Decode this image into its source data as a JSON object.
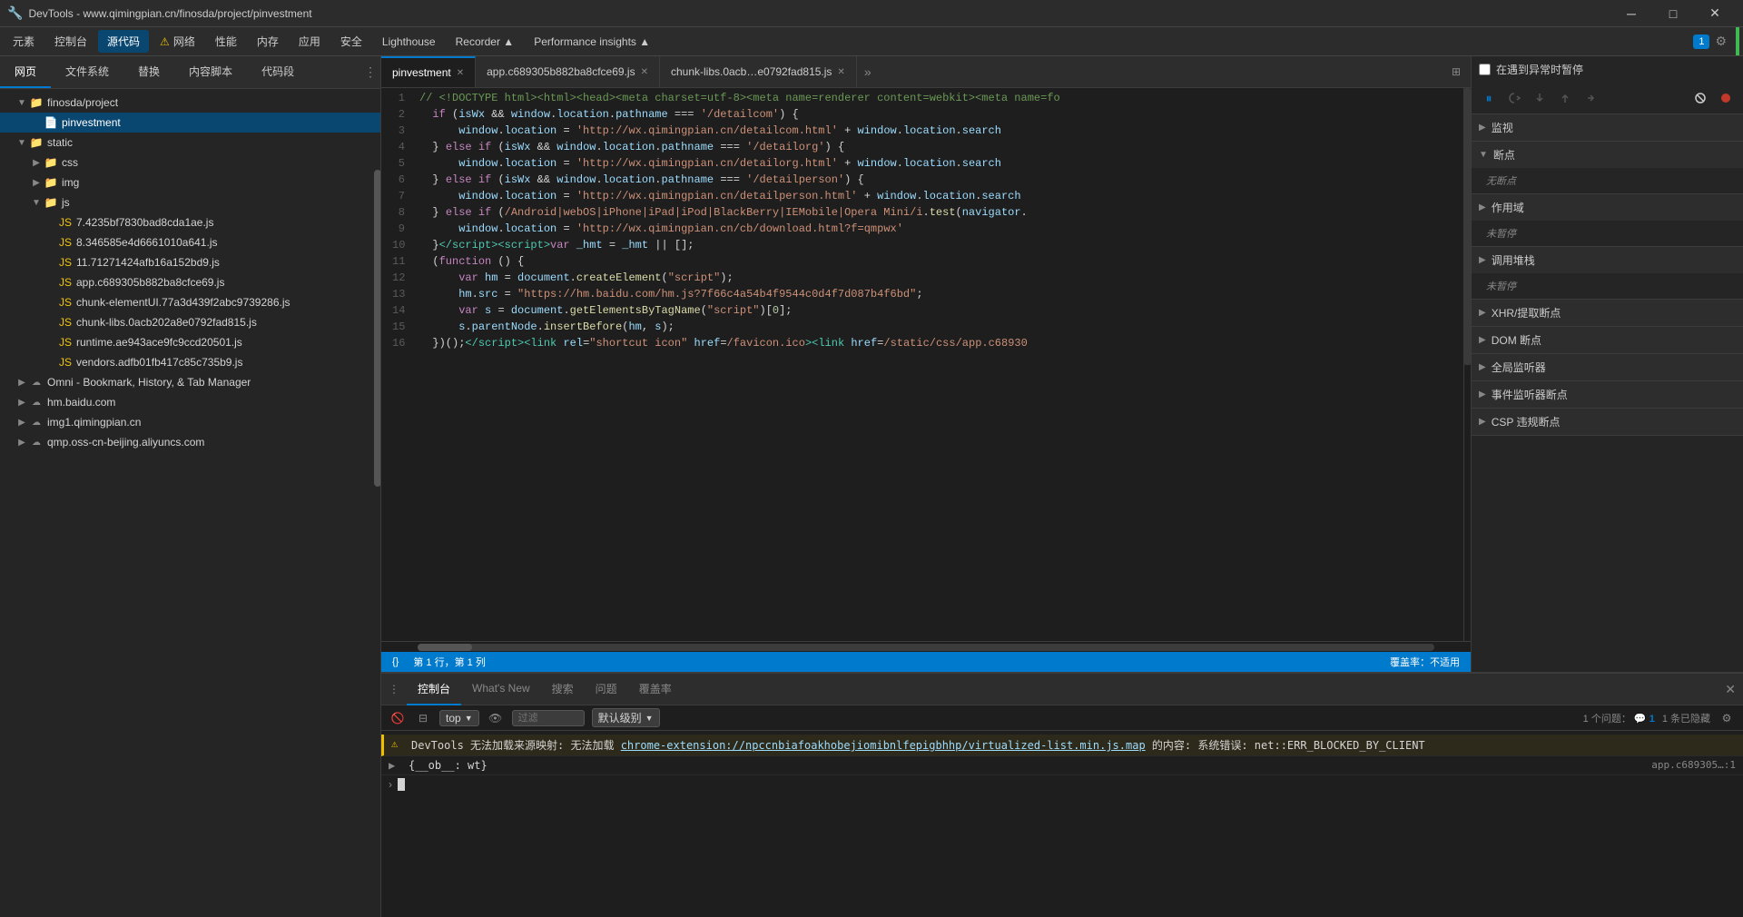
{
  "titlebar": {
    "title": "DevTools - www.qimingpian.cn/finosda/project/pinvestment",
    "favicon": "🔧",
    "min": "─",
    "max": "□",
    "close": "✕"
  },
  "menubar": {
    "items": [
      "元素",
      "控制台",
      "源代码",
      "网络",
      "性能",
      "内存",
      "应用",
      "安全",
      "Lighthouse",
      "Recorder ▲",
      "Performance insights ▲"
    ],
    "active": "源代码",
    "warning_label": "⚠",
    "right_items": [
      "1",
      "⚙"
    ]
  },
  "file_panel": {
    "tabs": [
      "网页",
      "文件系统",
      "替换",
      "内容脚本",
      "代码段"
    ],
    "active_tab": "网页",
    "tree": [
      {
        "indent": 0,
        "arrow": "▼",
        "icon": "folder",
        "label": "finosda/project",
        "type": "folder"
      },
      {
        "indent": 1,
        "arrow": "",
        "icon": "file",
        "label": "pinvestment",
        "type": "file",
        "selected": true
      },
      {
        "indent": 0,
        "arrow": "▼",
        "icon": "folder",
        "label": "static",
        "type": "folder"
      },
      {
        "indent": 1,
        "arrow": "▶",
        "icon": "folder",
        "label": "css",
        "type": "folder"
      },
      {
        "indent": 1,
        "arrow": "▶",
        "icon": "folder",
        "label": "img",
        "type": "folder"
      },
      {
        "indent": 1,
        "arrow": "▼",
        "icon": "folder",
        "label": "js",
        "type": "folder"
      },
      {
        "indent": 2,
        "arrow": "",
        "icon": "js",
        "label": "7.4235bf7830bad8cda1ae.js",
        "type": "js"
      },
      {
        "indent": 2,
        "arrow": "",
        "icon": "js",
        "label": "8.346585e4d6661010a641.js",
        "type": "js"
      },
      {
        "indent": 2,
        "arrow": "",
        "icon": "js",
        "label": "11.71271424afb16a152bd9.js",
        "type": "js"
      },
      {
        "indent": 2,
        "arrow": "",
        "icon": "js",
        "label": "app.c689305b882ba8cfce69.js",
        "type": "js"
      },
      {
        "indent": 2,
        "arrow": "",
        "icon": "js",
        "label": "chunk-elementUI.77a3d439f2abc9739286.js",
        "type": "js"
      },
      {
        "indent": 2,
        "arrow": "",
        "icon": "js",
        "label": "chunk-libs.0acb202a8e0792fad815.js",
        "type": "js"
      },
      {
        "indent": 2,
        "arrow": "",
        "icon": "js",
        "label": "runtime.ae943ace9fc9ccd20501.js",
        "type": "js"
      },
      {
        "indent": 2,
        "arrow": "",
        "icon": "js",
        "label": "vendors.adfb01fb417c85c735b9.js",
        "type": "js"
      },
      {
        "indent": 0,
        "arrow": "▶",
        "icon": "cloud",
        "label": "Omni - Bookmark, History, & Tab Manager",
        "type": "cloud"
      },
      {
        "indent": 0,
        "arrow": "▶",
        "icon": "cloud",
        "label": "hm.baidu.com",
        "type": "cloud"
      },
      {
        "indent": 0,
        "arrow": "▶",
        "icon": "cloud",
        "label": "img1.qimingpian.cn",
        "type": "cloud"
      },
      {
        "indent": 0,
        "arrow": "▶",
        "icon": "cloud",
        "label": "qmp.oss-cn-beijing.aliyuncs.com",
        "type": "cloud"
      }
    ]
  },
  "editor": {
    "tabs": [
      {
        "label": "pinvestment",
        "active": true,
        "closable": true
      },
      {
        "label": "app.c689305b882ba8cfce69.js",
        "active": false,
        "closable": true
      },
      {
        "label": "chunk-libs.0acb…e0792fad815.js",
        "active": false,
        "closable": true
      }
    ],
    "more": "»",
    "lines": [
      {
        "num": "1",
        "html": "<span class='cmt'>// &lt;!DOCTYPE html&gt;&lt;html&gt;&lt;head&gt;&lt;meta charset=utf-8&gt;&lt;meta name=renderer content=webkit&gt;&lt;meta name=fo</span>"
      },
      {
        "num": "2",
        "html": "  <span class='kw'>if</span> <span class='punc'>(</span><span class='var'>isWx</span> <span class='op'>&amp;&amp;</span> <span class='var'>window</span><span class='punc'>.</span><span class='var'>location</span><span class='punc'>.</span><span class='var'>pathname</span> <span class='op'>===</span> <span class='str'>'/detailcom'</span><span class='punc'>) {</span>"
      },
      {
        "num": "3",
        "html": "      <span class='var'>window</span><span class='punc'>.</span><span class='var'>location</span> <span class='op'>=</span> <span class='str'>'http://wx.qimingpian.cn/detailcom.html'</span> <span class='op'>+</span> <span class='var'>window</span><span class='punc'>.</span><span class='var'>location</span><span class='punc'>.</span><span class='var'>search</span>"
      },
      {
        "num": "4",
        "html": "  <span class='punc'>}</span> <span class='kw'>else if</span> <span class='punc'>(</span><span class='var'>isWx</span> <span class='op'>&amp;&amp;</span> <span class='var'>window</span><span class='punc'>.</span><span class='var'>location</span><span class='punc'>.</span><span class='var'>pathname</span> <span class='op'>===</span> <span class='str'>'/detailorg'</span><span class='punc'>) {</span>"
      },
      {
        "num": "5",
        "html": "      <span class='var'>window</span><span class='punc'>.</span><span class='var'>location</span> <span class='op'>=</span> <span class='str'>'http://wx.qimingpian.cn/detailorg.html'</span> <span class='op'>+</span> <span class='var'>window</span><span class='punc'>.</span><span class='var'>location</span><span class='punc'>.</span><span class='var'>search</span>"
      },
      {
        "num": "6",
        "html": "  <span class='punc'>}</span> <span class='kw'>else if</span> <span class='punc'>(</span><span class='var'>isWx</span> <span class='op'>&amp;&amp;</span> <span class='var'>window</span><span class='punc'>.</span><span class='var'>location</span><span class='punc'>.</span><span class='var'>pathname</span> <span class='op'>===</span> <span class='str'>'/detailperson'</span><span class='punc'>) {</span>"
      },
      {
        "num": "7",
        "html": "      <span class='var'>window</span><span class='punc'>.</span><span class='var'>location</span> <span class='op'>=</span> <span class='str'>'http://wx.qimingpian.cn/detailperson.html'</span> <span class='op'>+</span> <span class='var'>window</span><span class='punc'>.</span><span class='var'>location</span><span class='punc'>.</span><span class='var'>search</span>"
      },
      {
        "num": "8",
        "html": "  <span class='punc'>}</span> <span class='kw'>else if</span> <span class='punc'>(</span><span class='str'>/Android|webOS|iPhone|iPad|iPod|BlackBerry|IEMobile|Opera Mini/i</span><span class='punc'>.</span><span class='fn'>test</span><span class='punc'>(</span><span class='var'>navigator</span><span class='punc'>.</span>"
      },
      {
        "num": "9",
        "html": "      <span class='var'>window</span><span class='punc'>.</span><span class='var'>location</span> <span class='op'>=</span> <span class='str'>'http://wx.qimingpian.cn/cb/download.html?f=qmpwx'</span>"
      },
      {
        "num": "10",
        "html": "  <span class='punc'>}</span><span class='tag'>&lt;/script&gt;</span><span class='tag'>&lt;script&gt;</span><span class='kw'>var</span> <span class='var'>_hmt</span> <span class='op'>=</span> <span class='var'>_hmt</span> <span class='op'>||</span> <span class='punc'>[];</span>"
      },
      {
        "num": "11",
        "html": "  <span class='punc'>(</span><span class='kw'>function</span> <span class='punc'>() {</span>"
      },
      {
        "num": "12",
        "html": "      <span class='kw'>var</span> <span class='var'>hm</span> <span class='op'>=</span> <span class='var'>document</span><span class='punc'>.</span><span class='fn'>createElement</span><span class='punc'>(</span><span class='str'>\"script\"</span><span class='punc'>);</span>"
      },
      {
        "num": "13",
        "html": "      <span class='var'>hm</span><span class='punc'>.</span><span class='var'>src</span> <span class='op'>=</span> <span class='str'>\"https://hm.baidu.com/hm.js?7f66c4a54b4f9544c0d4f7d087b4f6bd\"</span><span class='punc'>;</span>"
      },
      {
        "num": "14",
        "html": "      <span class='kw'>var</span> <span class='var'>s</span> <span class='op'>=</span> <span class='var'>document</span><span class='punc'>.</span><span class='fn'>getElementsByTagName</span><span class='punc'>(</span><span class='str'>\"script\"</span><span class='punc'>)[</span><span class='num'>0</span><span class='punc'>];</span>"
      },
      {
        "num": "15",
        "html": "      <span class='var'>s</span><span class='punc'>.</span><span class='var'>parentNode</span><span class='punc'>.</span><span class='fn'>insertBefore</span><span class='punc'>(</span><span class='var'>hm</span><span class='punc'>,</span> <span class='var'>s</span><span class='punc'>);</span>"
      },
      {
        "num": "16",
        "html": "  <span class='punc'>})();</span><span class='tag'>&lt;/script&gt;</span><span class='tag'>&lt;link</span> <span class='attr'>rel</span><span class='op'>=</span><span class='str'>\"shortcut icon\"</span> <span class='attr'>href</span><span class='op'>=</span><span class='val'>/favicon.ico</span><span class='tag'>&gt;</span><span class='tag'>&lt;link</span> <span class='attr'>href</span><span class='op'>=</span><span class='val'>/static/css/app.c68930</span>"
      }
    ],
    "status": {
      "bracket": "{}",
      "position": "第 1 行，第 1 列",
      "coverage": "覆盖率：不适用"
    }
  },
  "debugger": {
    "toolbar": {
      "pause": "⏸",
      "resume": "↺",
      "step_over": "↓",
      "step_into": "↑",
      "step_out": "→",
      "step_back": "←",
      "deactivate": "⚡",
      "disable": "⏺"
    },
    "pause_on_exception": "在遇到异常时暂停",
    "sections": [
      {
        "label": "监视",
        "arrow": "▶",
        "collapsed": true,
        "content": ""
      },
      {
        "label": "断点",
        "arrow": "▼",
        "collapsed": false,
        "content": "无断点"
      },
      {
        "label": "作用域",
        "arrow": "▶",
        "collapsed": true,
        "content": "未暂停"
      },
      {
        "label": "调用堆栈",
        "arrow": "▶",
        "collapsed": true,
        "content": "未暂停"
      },
      {
        "label": "XHR/提取断点",
        "arrow": "▶",
        "collapsed": true,
        "content": ""
      },
      {
        "label": "DOM 断点",
        "arrow": "▶",
        "collapsed": true,
        "content": ""
      },
      {
        "label": "全局监听器",
        "arrow": "▶",
        "collapsed": true,
        "content": ""
      },
      {
        "label": "事件监听器断点",
        "arrow": "▶",
        "collapsed": true,
        "content": ""
      },
      {
        "label": "CSP 违规断点",
        "arrow": "▶",
        "collapsed": true,
        "content": ""
      }
    ]
  },
  "bottom_panel": {
    "tabs": [
      "控制台",
      "What's New",
      "搜索",
      "问题",
      "覆盖率"
    ],
    "active_tab": "控制台",
    "console": {
      "filter_placeholder": "过滤",
      "level_label": "默认级别",
      "issues_count": "1 个问题：",
      "issues_badge": "1",
      "hidden_count": "1 条已隐藏",
      "settings_icon": "⚙",
      "top_label": "top",
      "eye_icon": "👁",
      "no_entry_icon": "🚫",
      "warning_line": {
        "icon": "⚠",
        "text": "DevTools 无法加载来源映射: 无法加载 ",
        "link": "chrome-extension://npccnbiafoakhobejiomibnlfepigbhhp/virtualized-list.min.js.map",
        "text2": " 的内容: 系统错误: net::ERR_BLOCKED_BY_CLIENT"
      },
      "obj_line": {
        "expand": "▶",
        "text": "{__ob__: wt}",
        "source": "app.c689305…:1"
      },
      "prompt_arrow": ">"
    }
  }
}
